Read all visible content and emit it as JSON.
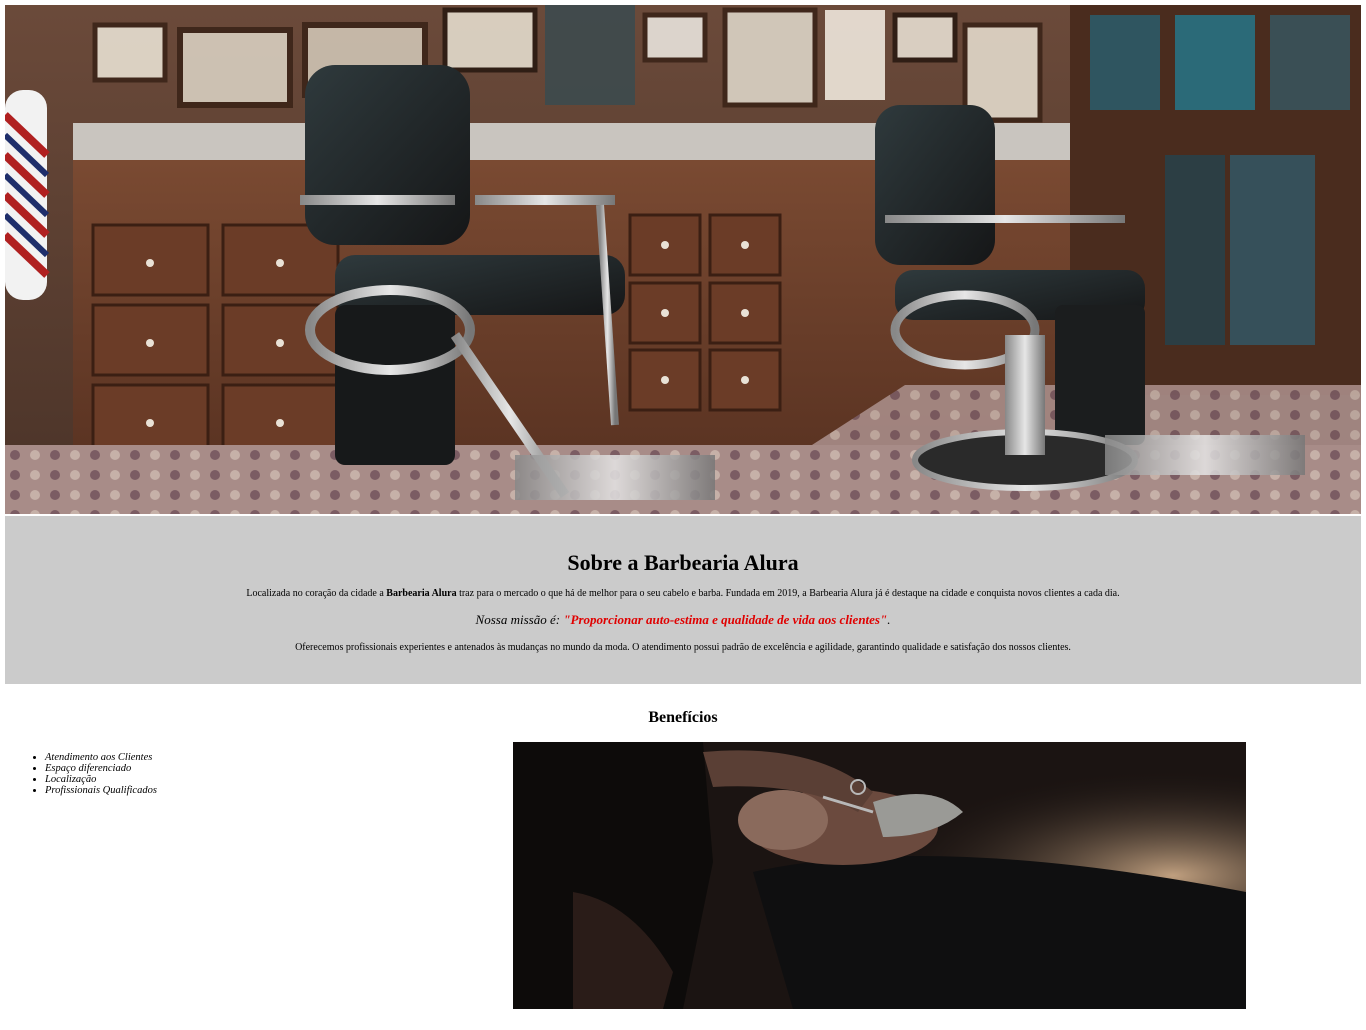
{
  "hero": {
    "image": "barbershop-interior-photo"
  },
  "about": {
    "title": "Sobre a Barbearia Alura",
    "intro_before": "Localizada no coração da cidade a ",
    "intro_bold": "Barbearia Alura",
    "intro_after": " traz para o mercado o que há de melhor para o seu cabelo e barba. Fundada em 2019, a Barbearia Alura já é destaque na cidade e conquista novos clientes a cada dia.",
    "mission_label": "Nossa missão é: ",
    "mission_quote": "\"Proporcionar auto-estima e qualidade de vida aos clientes\"",
    "mission_end": ".",
    "details": "Oferecemos profissionais experientes e antenados às mudanças no mundo da moda. O atendimento possui padrão de excelência e agilidade, garantindo qualidade e satisfação dos nossos clientes."
  },
  "benefits": {
    "title": "Benefícios",
    "items": [
      "Atendimento aos Clientes",
      "Espaço diferenciado",
      "Localização",
      "Profissionais Qualificados"
    ],
    "image": "beard-trim-photo"
  },
  "colors": {
    "about_background": "#cbcbcb",
    "mission_highlight": "#e00000"
  }
}
